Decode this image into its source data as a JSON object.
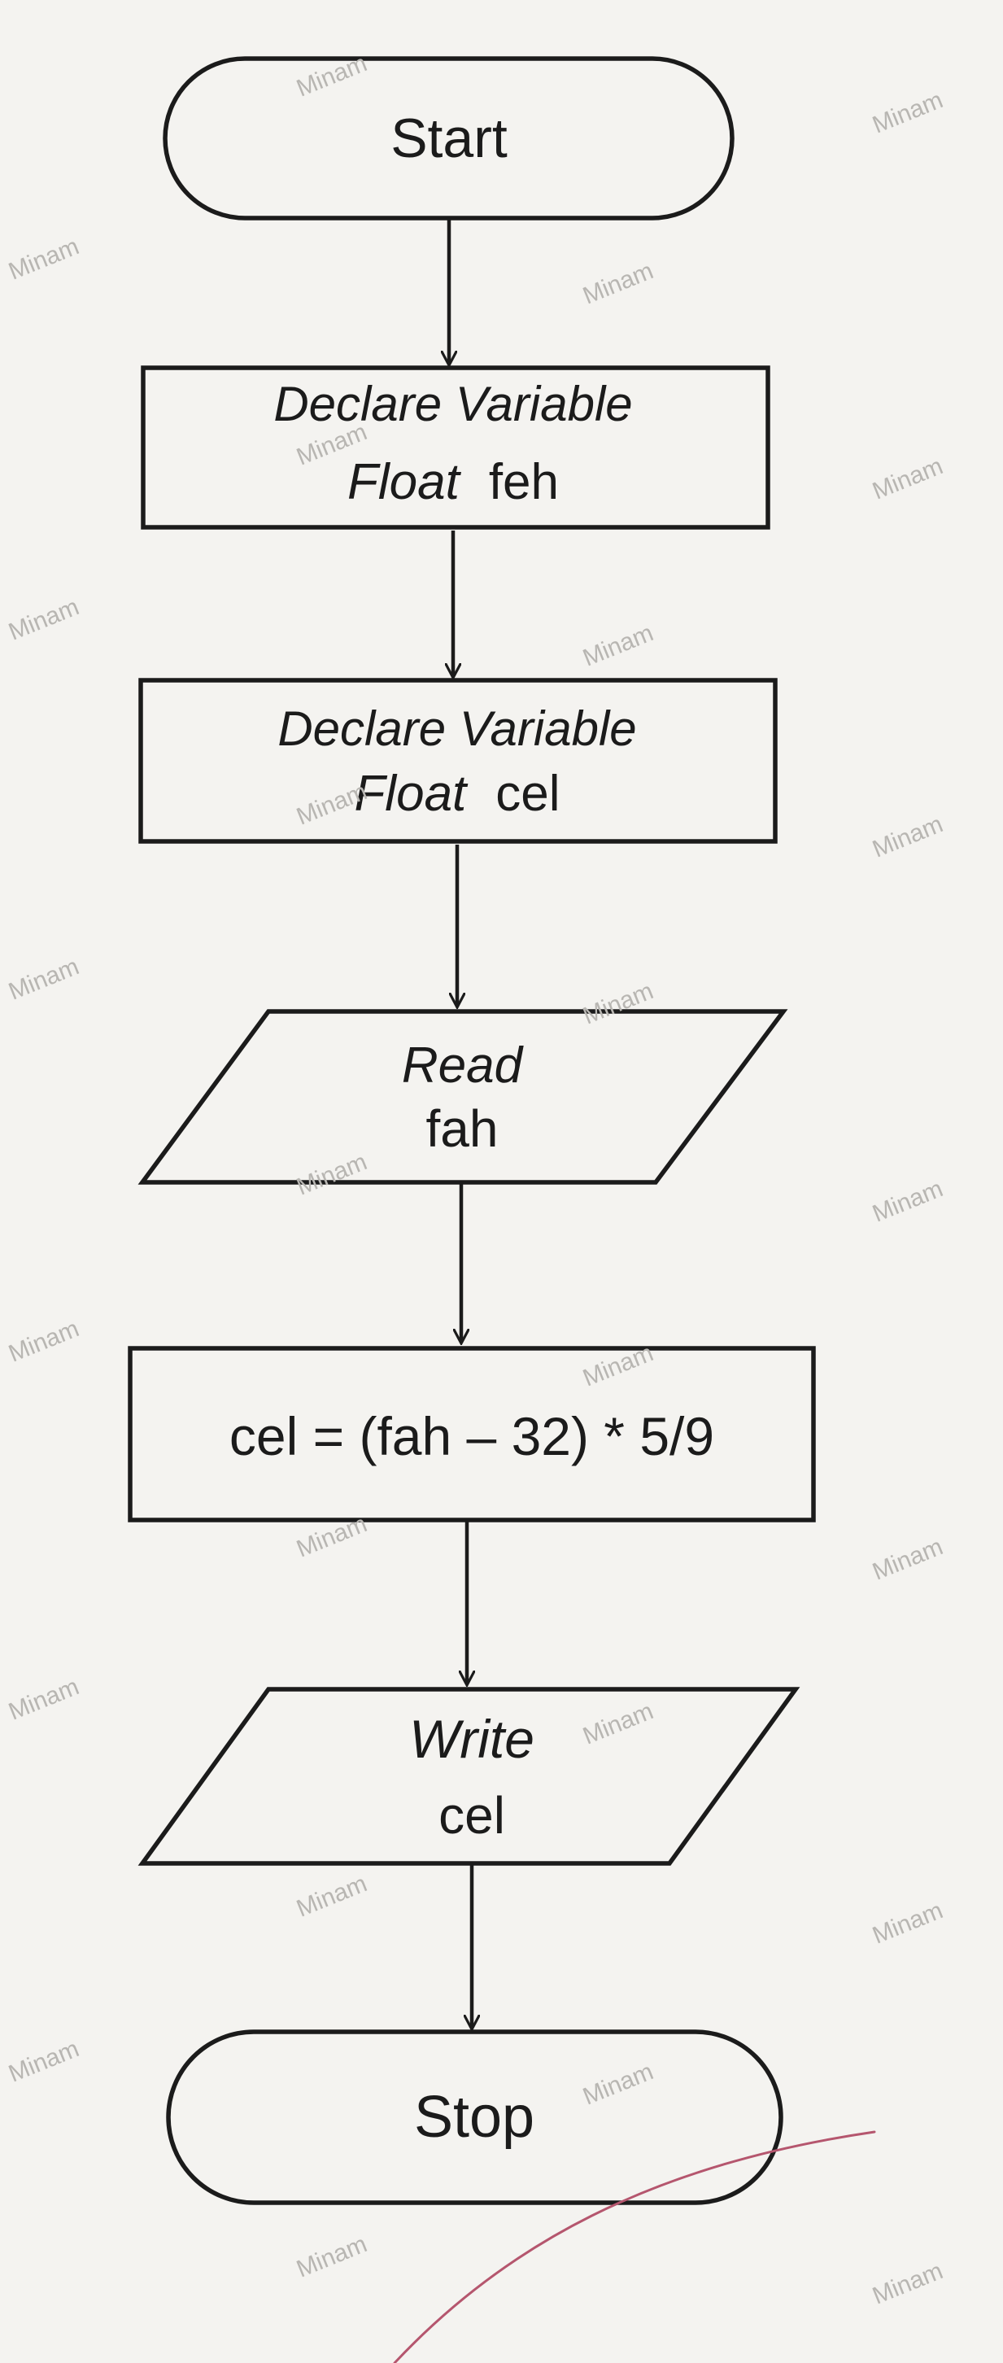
{
  "flowchart": {
    "start": {
      "label": "Start"
    },
    "declare_feh": {
      "line1": "Declare Variable",
      "line2_type": "Float",
      "line2_name": "feh"
    },
    "declare_cel": {
      "line1": "Declare Variable",
      "line2_type": "Float",
      "line2_name": "cel"
    },
    "read": {
      "line1": "Read",
      "line2": "fah"
    },
    "process": {
      "label": "cel = (fah – 32) * 5/9"
    },
    "write": {
      "line1": "Write",
      "line2": "cel"
    },
    "stop": {
      "label": "Stop"
    }
  },
  "watermark": {
    "text": "Minam"
  },
  "colors": {
    "stroke": "#1b1b1b",
    "background": "#f4f3f0",
    "pen_mark": "#b5566e"
  }
}
